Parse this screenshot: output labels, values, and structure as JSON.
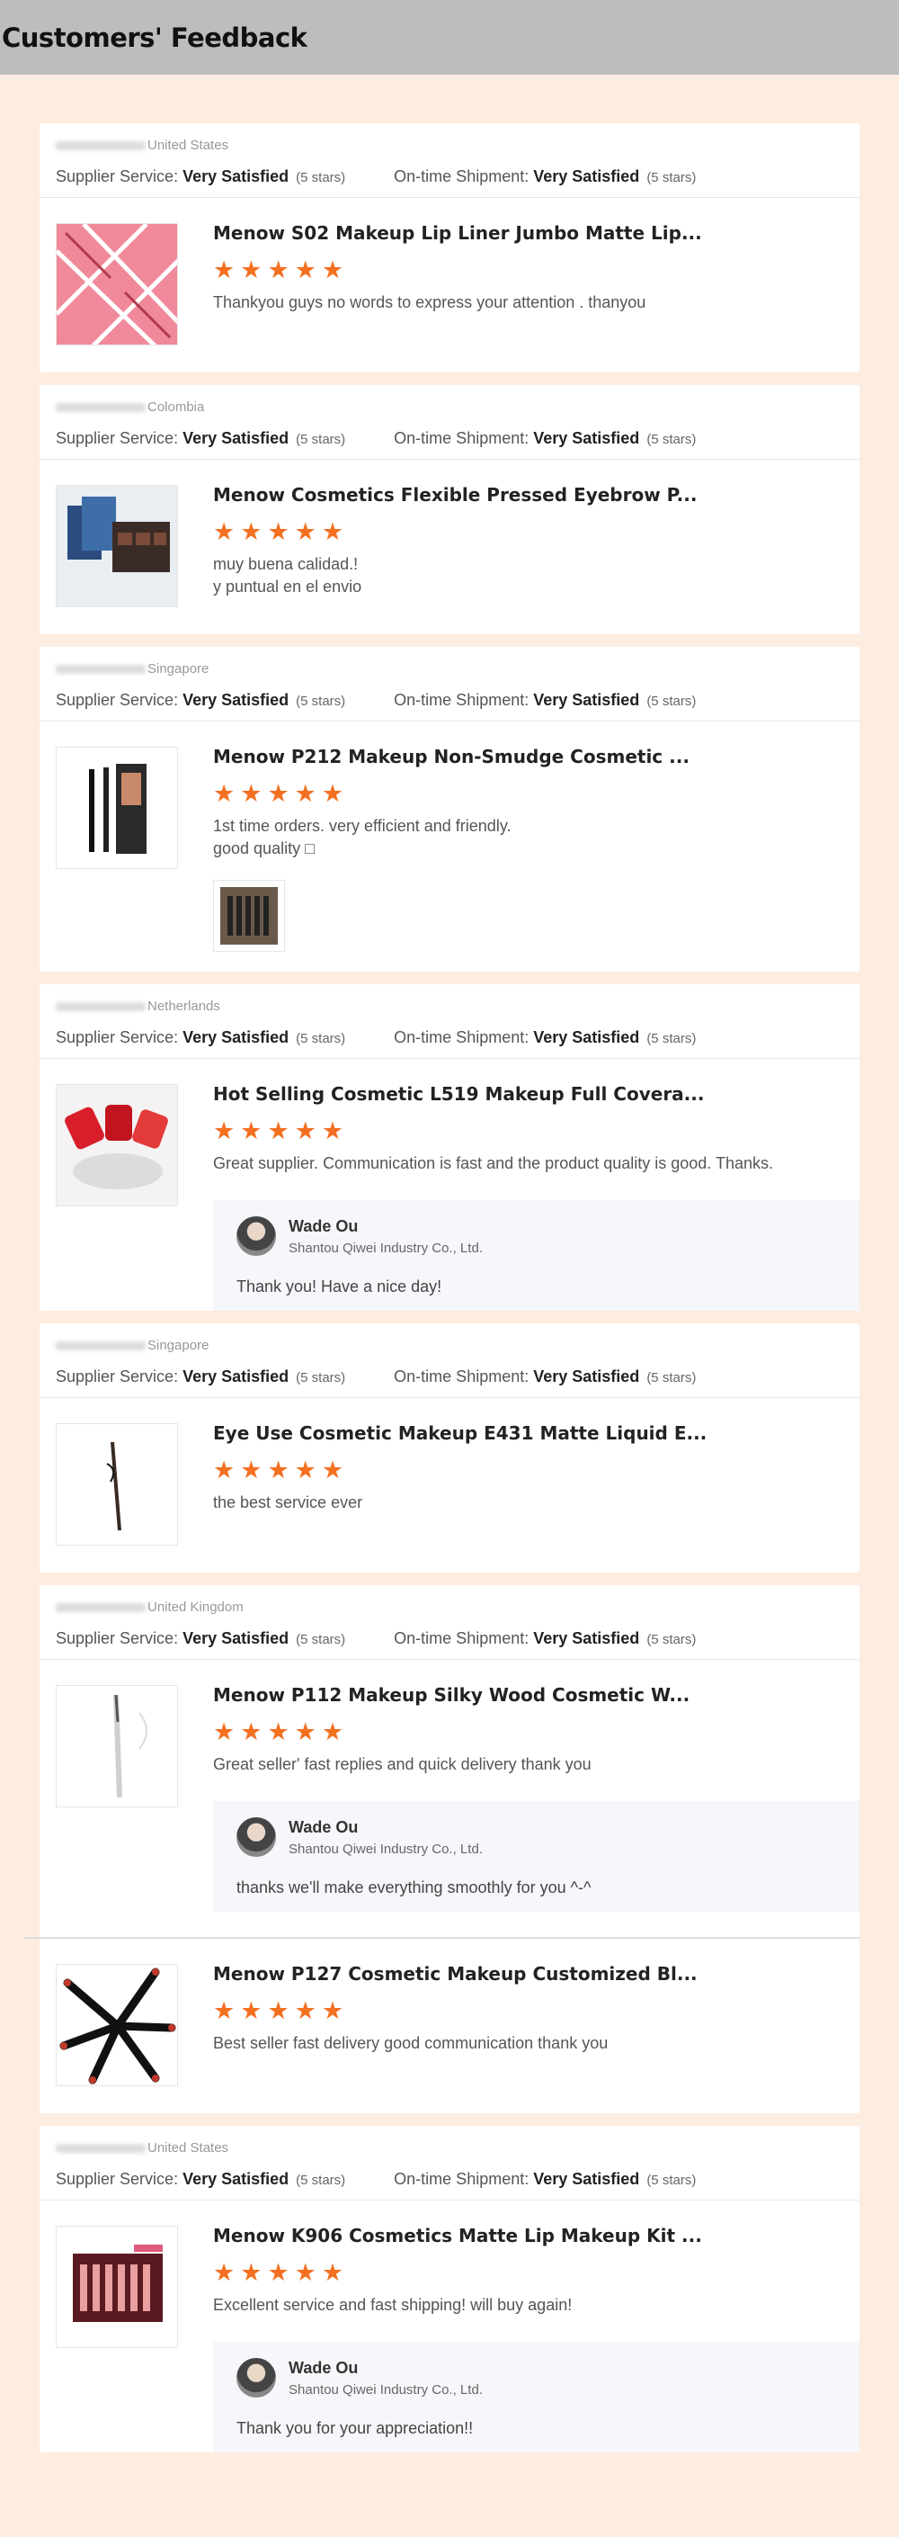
{
  "header": {
    "title": "Customers' Feedback"
  },
  "labels": {
    "supplier_service": "Supplier Service:",
    "on_time_shipment": "On-time Shipment:",
    "rating_word": "Very Satisfied",
    "rating_note": "(5 stars)"
  },
  "accent_color": "#f37021",
  "reviews": [
    {
      "country": "United States",
      "orders": [
        {
          "title": "Menow S02 Makeup Lip Liner Jumbo Matte Lip...",
          "stars": 5,
          "text": "Thankyou guys  no words to express your attention   . thanyou"
        }
      ]
    },
    {
      "country": "Colombia",
      "orders": [
        {
          "title": "Menow Cosmetics Flexible Pressed Eyebrow P...",
          "stars": 5,
          "text": "muy buena calidad.!\ny puntual en el envio"
        }
      ]
    },
    {
      "country": "Singapore",
      "orders": [
        {
          "title": "Menow P212 Makeup Non-Smudge Cosmetic ...",
          "stars": 5,
          "text": "1st time orders. very efficient and friendly.\ngood quality □"
        }
      ]
    },
    {
      "country": "Netherlands",
      "orders": [
        {
          "title": "Hot Selling Cosmetic L519 Makeup Full Covera...",
          "stars": 5,
          "text": "Great supplier. Communication is fast and the product quality is good. Thanks.",
          "reply": {
            "name": "Wade Ou",
            "company": "Shantou Qiwei Industry Co., Ltd.",
            "text": "Thank you! Have a nice day!"
          }
        }
      ]
    },
    {
      "country": "Singapore",
      "orders": [
        {
          "title": "Eye Use Cosmetic Makeup E431 Matte Liquid E...",
          "stars": 5,
          "text": "the best service ever"
        }
      ]
    },
    {
      "country": "United Kingdom",
      "orders": [
        {
          "title": "Menow P112 Makeup Silky Wood Cosmetic W...",
          "stars": 5,
          "text": "Great seller' fast replies and quick delivery thank you",
          "reply": {
            "name": "Wade Ou",
            "company": "Shantou Qiwei Industry Co., Ltd.",
            "text": "thanks we'll make everything smoothly for you ^-^"
          }
        },
        {
          "title": "Menow P127 Cosmetic Makeup Customized Bl...",
          "stars": 5,
          "text": "Best seller fast delivery good communication thank you"
        }
      ]
    },
    {
      "country": "United States",
      "orders": [
        {
          "title": "Menow K906 Cosmetics Matte Lip Makeup Kit ...",
          "stars": 5,
          "text": "Excellent service and fast shipping! will buy again!",
          "reply": {
            "name": "Wade Ou",
            "company": "Shantou Qiwei Industry Co., Ltd.",
            "text": "Thank you for your appreciation!!"
          }
        }
      ]
    }
  ]
}
